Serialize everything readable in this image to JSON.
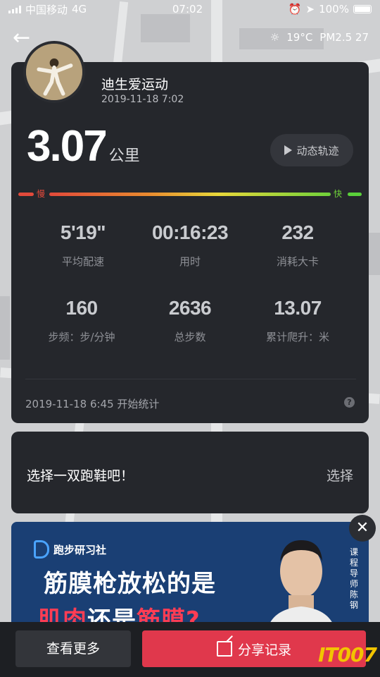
{
  "status_bar": {
    "carrier": "中国移动",
    "network": "4G",
    "time": "07:02",
    "battery": "100%"
  },
  "weather": {
    "temperature": "19°C",
    "pm25": "PM2.5 27"
  },
  "user": {
    "name": "迪生爱运动",
    "datetime": "2019-11-18 7:02"
  },
  "run": {
    "distance": "3.07",
    "distance_unit": "公里",
    "track_button": "动态轨迹",
    "pace_slow": "慢",
    "pace_fast": "快"
  },
  "stats": [
    {
      "value": "5'19\"",
      "label": "平均配速"
    },
    {
      "value": "00:16:23",
      "label": "用时"
    },
    {
      "value": "232",
      "label": "消耗大卡"
    },
    {
      "value": "160",
      "label": "步频：步/分钟"
    },
    {
      "value": "2636",
      "label": "总步数"
    },
    {
      "value": "13.07",
      "label": "累计爬升：米"
    }
  ],
  "start_info": "2019-11-18 6:45 开始统计",
  "help": "?",
  "shoe": {
    "prompt": "选择一双跑鞋吧！",
    "action": "选择"
  },
  "ad": {
    "brand": "跑步研习社",
    "headline1": "筋膜枪放松的是",
    "headline2_red1": "肌肉",
    "headline2_white": "还是",
    "headline2_red2": "筋膜?",
    "side_text": "课程导师 陈钢",
    "close": "✕"
  },
  "bottom": {
    "more": "查看更多",
    "share": "分享记录"
  },
  "watermark": "IT007",
  "colors": {
    "card_bg": "#25272c",
    "accent_red": "#e0384c",
    "pace_green": "#6fd13a"
  }
}
